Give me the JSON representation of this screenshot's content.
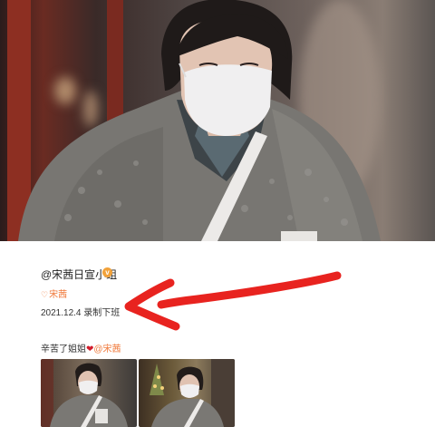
{
  "post": {
    "username": "@宋茜日宣小组",
    "verified_badge": "v",
    "tag_heart": "♡",
    "tag": "宋茜",
    "date_text": "2021.12.4 录制下班",
    "caption_prefix": "辛苦了姐姐",
    "caption_heart": "❤",
    "caption_mention": "@宋茜"
  },
  "colors": {
    "arrow": "#e8231f",
    "mention": "#f07a3c",
    "badge": "#f2a23a"
  }
}
